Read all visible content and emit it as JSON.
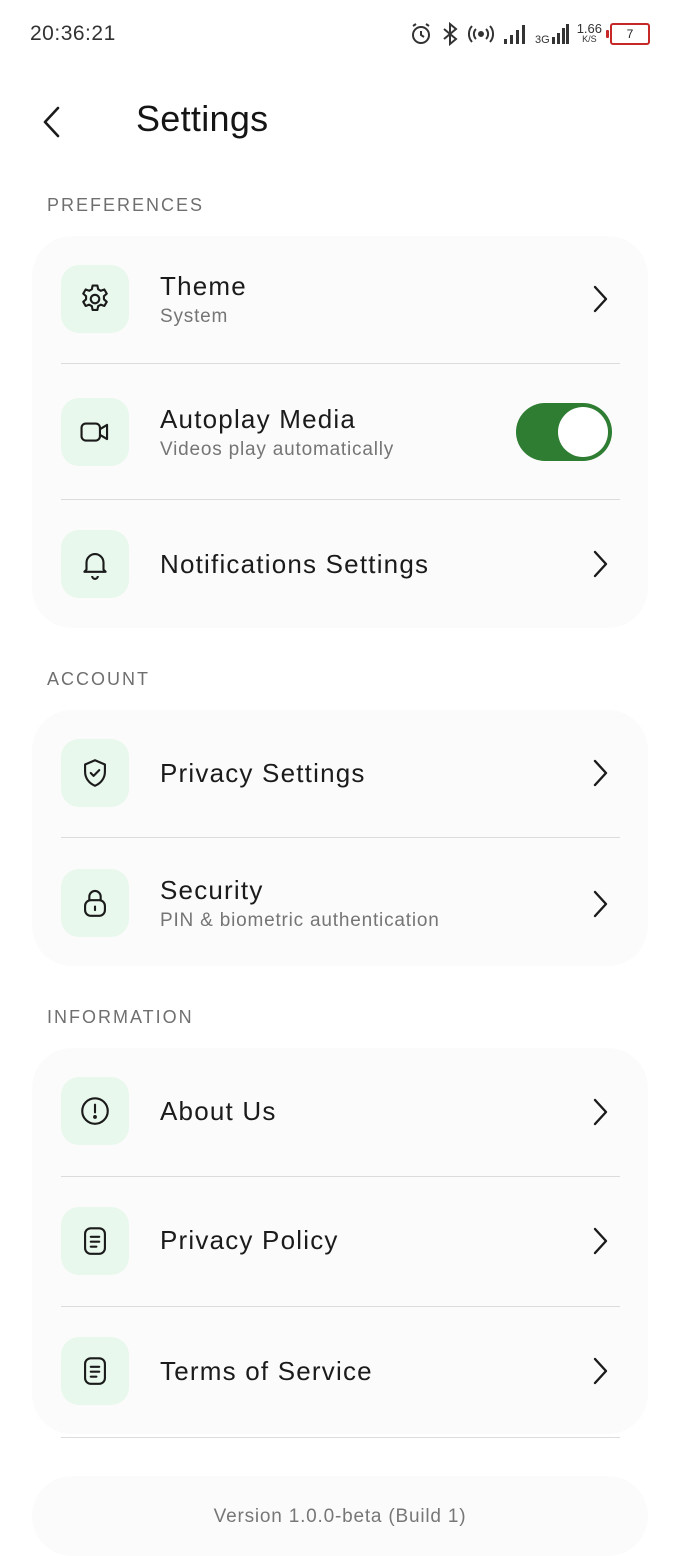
{
  "status_bar": {
    "time": "20:36:21",
    "network_speed": "1.66",
    "network_speed_unit": "K/S",
    "network_type": "3G",
    "battery_level": "7",
    "battery_color": "#c62828"
  },
  "header": {
    "title": "Settings",
    "back_icon": "chevron-left-icon"
  },
  "sections": [
    {
      "label": "PREFERENCES",
      "items": [
        {
          "icon": "gear-icon",
          "title": "Theme",
          "subtitle": "System",
          "control": "chevron"
        },
        {
          "icon": "video-camera-icon",
          "title": "Autoplay Media",
          "subtitle": "Videos play automatically",
          "control": "toggle",
          "toggle_on": true
        },
        {
          "icon": "bell-icon",
          "title": "Notifications Settings",
          "subtitle": "",
          "control": "chevron"
        }
      ]
    },
    {
      "label": "ACCOUNT",
      "items": [
        {
          "icon": "shield-check-icon",
          "title": "Privacy Settings",
          "subtitle": "",
          "control": "chevron"
        },
        {
          "icon": "lock-icon",
          "title": "Security",
          "subtitle": "PIN & biometric authentication",
          "control": "chevron"
        }
      ]
    },
    {
      "label": "INFORMATION",
      "items": [
        {
          "icon": "info-circle-icon",
          "title": "About Us",
          "subtitle": "",
          "control": "chevron"
        },
        {
          "icon": "document-icon",
          "title": "Privacy Policy",
          "subtitle": "",
          "control": "chevron"
        },
        {
          "icon": "document-icon",
          "title": "Terms of Service",
          "subtitle": "",
          "control": "chevron"
        }
      ]
    }
  ],
  "footer": {
    "version": "Version 1.0.0-beta (Build 1)"
  },
  "colors": {
    "accent": "#2e7d32",
    "icon_background": "#e8f8ec",
    "card_background": "#fbfbfb"
  }
}
